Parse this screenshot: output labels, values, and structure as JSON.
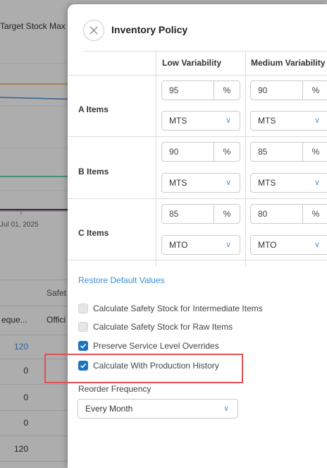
{
  "background": {
    "header_text": "Target Stock Max",
    "x_tick_label": "Jul 01, 2025",
    "table_header_1": "Safet",
    "col_a_header": "eque...",
    "col_b_header": "Offici",
    "rows": [
      "120",
      "0",
      "0",
      "0",
      "120"
    ],
    "line_colors": [
      "#e0b040",
      "#4a8fd0",
      "#40c0a0",
      "#5a2a6a"
    ]
  },
  "panel": {
    "close_icon": "close-icon",
    "title": "Inventory Policy",
    "columns": [
      "Low Variability",
      "Medium Variability"
    ],
    "rows": [
      {
        "label": "A Items",
        "low": {
          "value": "95",
          "unit": "%",
          "type": "MTS"
        },
        "medium": {
          "value": "90",
          "unit": "%",
          "type": "MTS"
        }
      },
      {
        "label": "B Items",
        "low": {
          "value": "90",
          "unit": "%",
          "type": "MTS"
        },
        "medium": {
          "value": "85",
          "unit": "%",
          "type": "MTS"
        }
      },
      {
        "label": "C Items",
        "low": {
          "value": "85",
          "unit": "%",
          "type": "MTO"
        },
        "medium": {
          "value": "80",
          "unit": "%",
          "type": "MTO"
        }
      }
    ],
    "restore_label": "Restore Default Values",
    "checkboxes": [
      {
        "label": "Calculate Safety Stock for Intermediate Items",
        "checked": false
      },
      {
        "label": "Calculate Safety Stock for Raw Items",
        "checked": false
      },
      {
        "label": "Preserve Service Level Overrides",
        "checked": true
      },
      {
        "label": "Calculate With Production History",
        "checked": true
      }
    ],
    "reorder_frequency_label": "Reorder Frequency",
    "reorder_frequency_value": "Every Month",
    "accent_color": "#1e73be",
    "highlight_color": "#e05050"
  }
}
